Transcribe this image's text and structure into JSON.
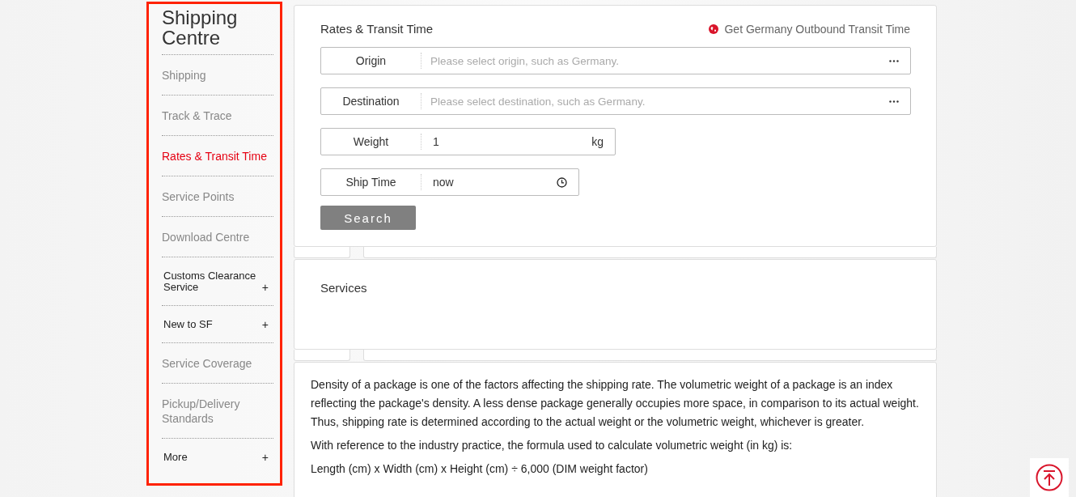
{
  "sidebar": {
    "title": "Shipping Centre",
    "items": [
      {
        "label": "Shipping",
        "kind": "link",
        "selected": false
      },
      {
        "label": "Track & Trace",
        "kind": "link",
        "selected": false
      },
      {
        "label": "Rates & Transit Time",
        "kind": "link",
        "selected": true
      },
      {
        "label": "Service Points",
        "kind": "link",
        "selected": false
      },
      {
        "label": "Download Centre",
        "kind": "link",
        "selected": false
      },
      {
        "label": "Customs Clearance Service",
        "kind": "expandable",
        "selected": false,
        "toggle": "+"
      },
      {
        "label": "New to SF",
        "kind": "expandable",
        "selected": false,
        "toggle": "+"
      },
      {
        "label": "Service Coverage",
        "kind": "link",
        "selected": false
      },
      {
        "label": "Pickup/Delivery Standards",
        "kind": "link",
        "selected": false
      },
      {
        "label": "More",
        "kind": "expandable",
        "selected": false,
        "toggle": "+"
      }
    ]
  },
  "rates_card": {
    "title": "Rates & Transit Time",
    "link": "Get Germany Outbound Transit Time",
    "fields": [
      {
        "label": "Origin",
        "kind": "picker",
        "placeholder": "Please select origin, such as Germany."
      },
      {
        "label": "Destination",
        "kind": "picker",
        "placeholder": "Please select destination, such as Germany."
      },
      {
        "label": "Weight",
        "kind": "unit",
        "value": "1",
        "unit": "kg"
      },
      {
        "label": "Ship Time",
        "kind": "time",
        "value": "now"
      }
    ],
    "button": "Search"
  },
  "services_card": {
    "title": "Services"
  },
  "info_card": {
    "paragraphs": [
      "Density of a package is one of the factors affecting the shipping rate. The volumetric weight of a package is an index reflecting the package's density. A less dense package generally occupies more space, in comparison to its actual weight. Thus, shipping rate is determined according to the actual weight or the volumetric weight, whichever is greater.",
      "With reference to the industry practice, the formula used to calculate volumetric weight (in kg) is:",
      "Length (cm) x Width (cm) x Height (cm) ÷ 6,000 (DIM weight factor)"
    ]
  }
}
